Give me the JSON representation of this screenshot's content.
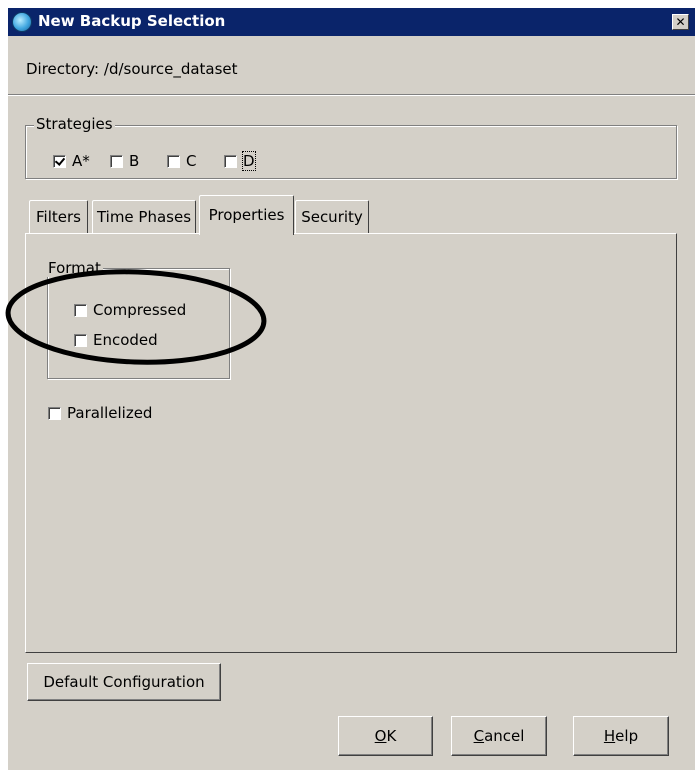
{
  "window": {
    "title": "New Backup Selection",
    "close_glyph": "✕"
  },
  "directory": {
    "label": "Directory:",
    "value": "/d/source_dataset"
  },
  "strategies": {
    "legend": "Strategies",
    "items": [
      {
        "label": "A*",
        "checked": true
      },
      {
        "label": "B",
        "checked": false
      },
      {
        "label": "C",
        "checked": false
      },
      {
        "label": "D",
        "checked": false
      }
    ]
  },
  "tabs": {
    "items": [
      "Filters",
      "Time Phases",
      "Properties",
      "Security"
    ],
    "active": "Properties"
  },
  "properties": {
    "format_legend": "Format",
    "compressed_label": "Compressed",
    "encoded_label": "Encoded",
    "parallelized_label": "Parallelized"
  },
  "buttons": {
    "default_config": "Default Configuration",
    "ok_mnemonic": "O",
    "ok_rest": "K",
    "cancel_mnemonic": "C",
    "cancel_rest": "ancel",
    "help_mnemonic": "H",
    "help_rest": "elp"
  },
  "colors": {
    "titlebar": "#0a246a",
    "window_bg": "#d4d0c8",
    "annotation": "#000000"
  }
}
